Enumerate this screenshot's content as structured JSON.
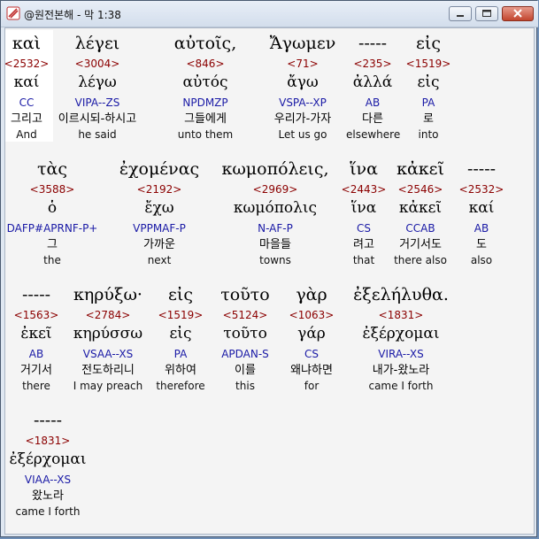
{
  "window": {
    "title": "@원전본해 - 막 1:38"
  },
  "rows": [
    [
      {
        "greek": "καὶ",
        "strong": "<2532>",
        "lexeme": "καί",
        "parse": "CC",
        "korean": "그리고",
        "english": "And",
        "selected": true
      },
      {
        "greek": "λέγει",
        "strong": "<3004>",
        "lexeme": "λέγω",
        "parse": "VIPA--ZS",
        "korean": "이르시되-하시고",
        "english": "he said"
      },
      {
        "greek": "αὐτοῖς,",
        "strong": "<846>",
        "lexeme": "αὐτός",
        "parse": "NPDMZP",
        "korean": "그들에게",
        "english": "unto them"
      },
      {
        "greek": "Ἄγωμεν",
        "strong": "<71>",
        "lexeme": "ἄγω",
        "parse": "VSPA--XP",
        "korean": "우리가-가자",
        "english": "Let us go"
      },
      {
        "greek": "-----",
        "strong": "<235>",
        "lexeme": "ἀλλά",
        "parse": "AB",
        "korean": "다른",
        "english": "elsewhere"
      },
      {
        "greek": "εἰς",
        "strong": "<1519>",
        "lexeme": "εἰς",
        "parse": "PA",
        "korean": "로",
        "english": "into"
      }
    ],
    [
      {
        "greek": "τὰς",
        "strong": "<3588>",
        "lexeme": "ὁ",
        "parse": "DAFP#APRNF-P+",
        "korean": "그",
        "english": "the"
      },
      {
        "greek": "ἐχομένας",
        "strong": "<2192>",
        "lexeme": "ἔχω",
        "parse": "VPPMAF-P",
        "korean": "가까운",
        "english": "next"
      },
      {
        "greek": "κωμοπόλεις,",
        "strong": "<2969>",
        "lexeme": "κωμόπολις",
        "parse": "N-AF-P",
        "korean": "마을들",
        "english": "towns"
      },
      {
        "greek": "ἵνα",
        "strong": "<2443>",
        "lexeme": "ἵνα",
        "parse": "CS",
        "korean": "려고",
        "english": "that"
      },
      {
        "greek": "κἀκεῖ",
        "strong": "<2546>",
        "lexeme": "κἀκεῖ",
        "parse": "CCAB",
        "korean": "거기서도",
        "english": "there also"
      },
      {
        "greek": "-----",
        "strong": "<2532>",
        "lexeme": "καί",
        "parse": "AB",
        "korean": "도",
        "english": "also"
      }
    ],
    [
      {
        "greek": "-----",
        "strong": "<1563>",
        "lexeme": "ἐκεῖ",
        "parse": "AB",
        "korean": "거기서",
        "english": "there"
      },
      {
        "greek": "κηρύξω·",
        "strong": "<2784>",
        "lexeme": "κηρύσσω",
        "parse": "VSAA--XS",
        "korean": "전도하리니",
        "english": "I may preach"
      },
      {
        "greek": "εἰς",
        "strong": "<1519>",
        "lexeme": "εἰς",
        "parse": "PA",
        "korean": "위하여",
        "english": "therefore"
      },
      {
        "greek": "τοῦτο",
        "strong": "<5124>",
        "lexeme": "τοῦτο",
        "parse": "APDAN-S",
        "korean": "이를",
        "english": "this"
      },
      {
        "greek": "γὰρ",
        "strong": "<1063>",
        "lexeme": "γάρ",
        "parse": "CS",
        "korean": "왜냐하면",
        "english": "for"
      },
      {
        "greek": "ἐξελήλυθα.",
        "strong": "<1831>",
        "lexeme": "ἐξέρχομαι",
        "parse": "VIRA--XS",
        "korean": "내가-왔노라",
        "english": "came I forth"
      }
    ],
    [
      {
        "greek": "-----",
        "strong": "<1831>",
        "lexeme": "ἐξέρχομαι",
        "parse": "VIAA--XS",
        "korean": "왔노라",
        "english": "came I forth"
      }
    ]
  ]
}
